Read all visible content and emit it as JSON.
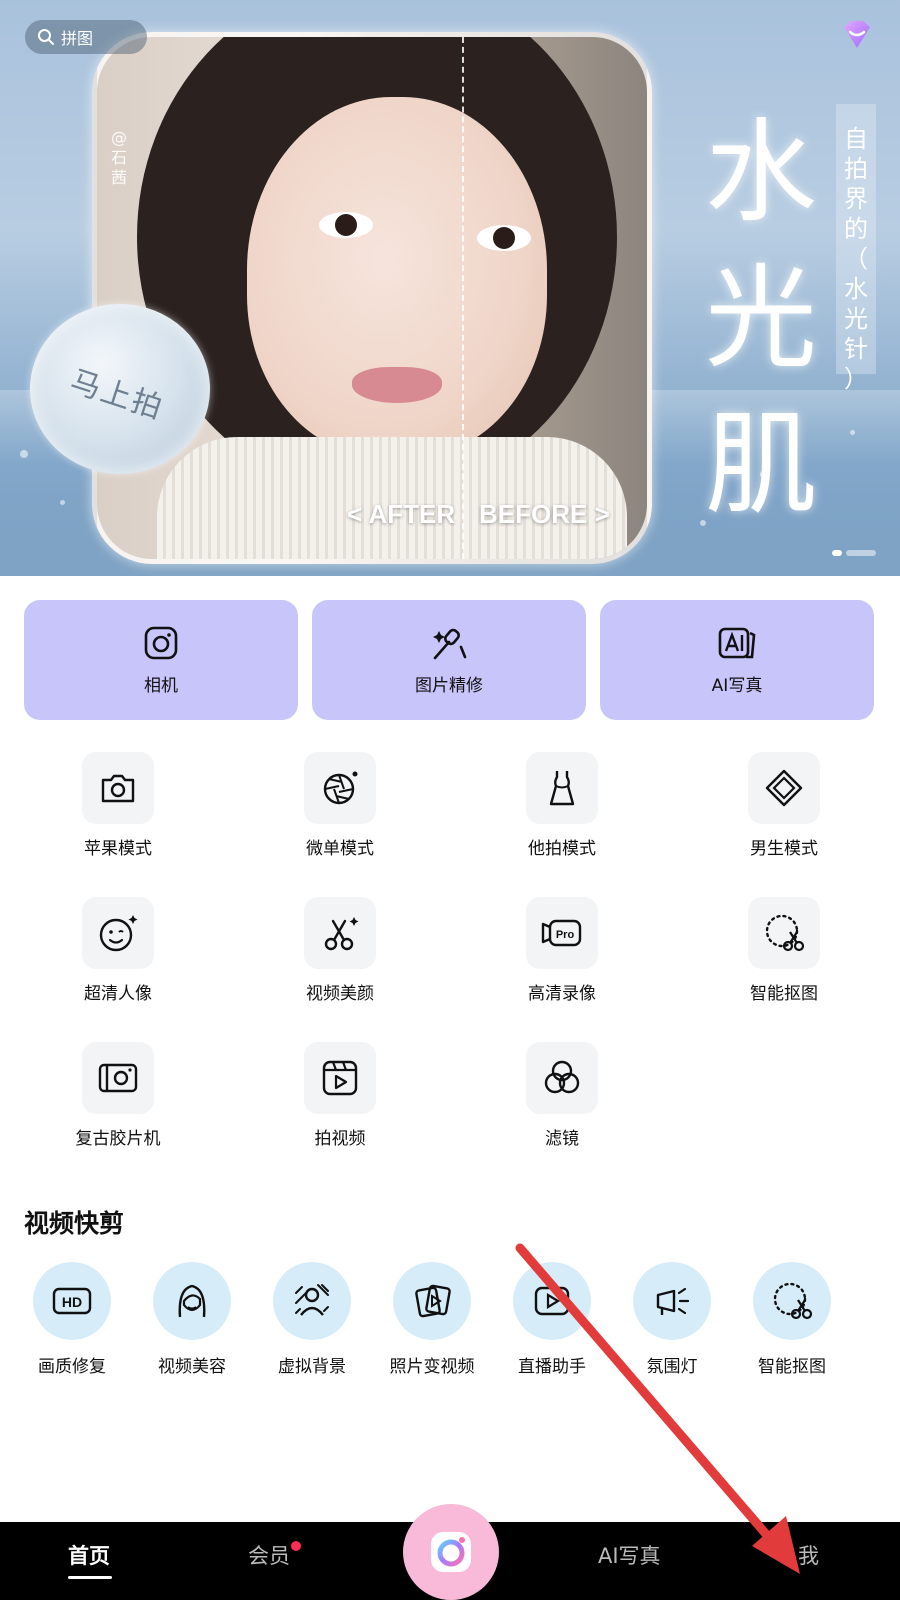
{
  "banner": {
    "search_placeholder": "拼图",
    "watermark": "@石茜",
    "shoot_button": "马上拍",
    "after_label": "< AFTER",
    "before_label": "BEFORE >",
    "title_chars": [
      "水",
      "光",
      "肌"
    ],
    "slogan_chars": [
      "自",
      "拍",
      "界",
      "的",
      "（",
      "水",
      "光",
      "针",
      "）"
    ],
    "carousel_dots": 3,
    "carousel_active_index": 0
  },
  "primary_tiles": [
    {
      "label": "相机",
      "icon": "camera-square-icon"
    },
    {
      "label": "图片精修",
      "icon": "makeup-brush-icon"
    },
    {
      "label": "AI写真",
      "icon": "ai-portrait-icon"
    }
  ],
  "modes": [
    {
      "label": "苹果模式",
      "icon": "camera-icon"
    },
    {
      "label": "微单模式",
      "icon": "aperture-icon"
    },
    {
      "label": "他拍模式",
      "icon": "dress-icon"
    },
    {
      "label": "男生模式",
      "icon": "diamond-icon"
    },
    {
      "label": "超清人像",
      "icon": "smile-face-icon"
    },
    {
      "label": "视频美颜",
      "icon": "scissors-sparkle-icon"
    },
    {
      "label": "高清录像",
      "icon": "pro-video-icon"
    },
    {
      "label": "智能抠图",
      "icon": "cutout-icon"
    },
    {
      "label": "复古胶片机",
      "icon": "film-camera-icon"
    },
    {
      "label": "拍视频",
      "icon": "video-clip-icon"
    },
    {
      "label": "滤镜",
      "icon": "filter-circles-icon"
    }
  ],
  "video_section": {
    "title": "视频快剪",
    "items": [
      {
        "label": "画质修复",
        "icon": "hd-icon"
      },
      {
        "label": "视频美容",
        "icon": "woman-face-icon"
      },
      {
        "label": "虚拟背景",
        "icon": "virtual-bg-icon"
      },
      {
        "label": "照片变视频",
        "icon": "photo-to-video-icon"
      },
      {
        "label": "直播助手",
        "icon": "live-stream-icon"
      },
      {
        "label": "氛围灯",
        "icon": "ambient-light-icon"
      },
      {
        "label": "智能抠图",
        "icon": "cutout-icon"
      }
    ]
  },
  "bottom_nav": {
    "home": "首页",
    "vip": "会员",
    "ai_portrait": "AI写真",
    "me": "我",
    "active": "home",
    "vip_has_badge": true
  },
  "colors": {
    "tile_purple": "#c8c5fb",
    "icon_bg_gray": "#f3f4f6",
    "video_icon_bg": "#d6edf9",
    "nav_bg": "#000000",
    "center_button": "#f9b9d8",
    "badge_red": "#ff2d55",
    "annotation_arrow": "#e23b3b"
  }
}
